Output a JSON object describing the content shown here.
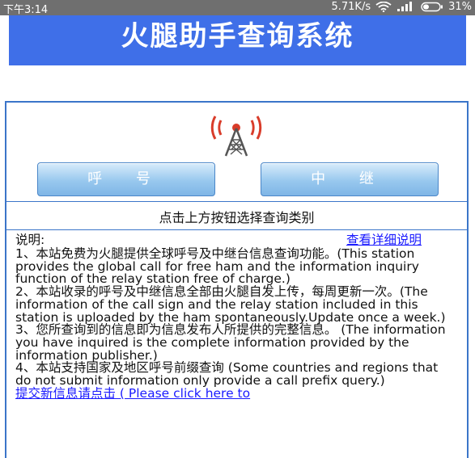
{
  "status_bar": {
    "time": "下午3:14",
    "network_speed": "5.71K/s",
    "battery": "31%",
    "icons": [
      "wifi-icon",
      "signal-icon",
      "battery-icon"
    ]
  },
  "header": {
    "title": "火腿助手查询系统",
    "background": "#3f6fe8"
  },
  "main": {
    "tower_icon": "radio-tower-icon",
    "buttons": {
      "callsign": "呼 号",
      "relay": "中 继"
    },
    "hint": "点击上方按钮选择查询类别",
    "notes": {
      "label": "说明:",
      "detail_link": "查看详细说明",
      "items": [
        "1、本站免费为火腿提供全球呼号及中继台信息查询功能。(This station provides the global call for free ham and the information inquiry function of the relay station free of charge.)",
        "2、本站收录的呼号及中继信息全部由火腿自发上传，每周更新一次。(The information of the call sign and the relay station included in this station is uploaded by the ham spontaneously.Update once a week.)",
        "3、您所查询到的信息即为信息发布人所提供的完整信息。 (The information you have inquired is the complete information provided by the information publisher.)",
        "4、本站支持国家及地区呼号前缀查询 (Some countries and regions that do not submit information only provide a call prefix query.)"
      ],
      "submit_link": "提交新信息请点击 ( Please click here to"
    }
  },
  "colors": {
    "accent": "#3f6fe8",
    "border": "#3b75c9",
    "link": "#1a1aff",
    "tower_red": "#d93c2a"
  }
}
